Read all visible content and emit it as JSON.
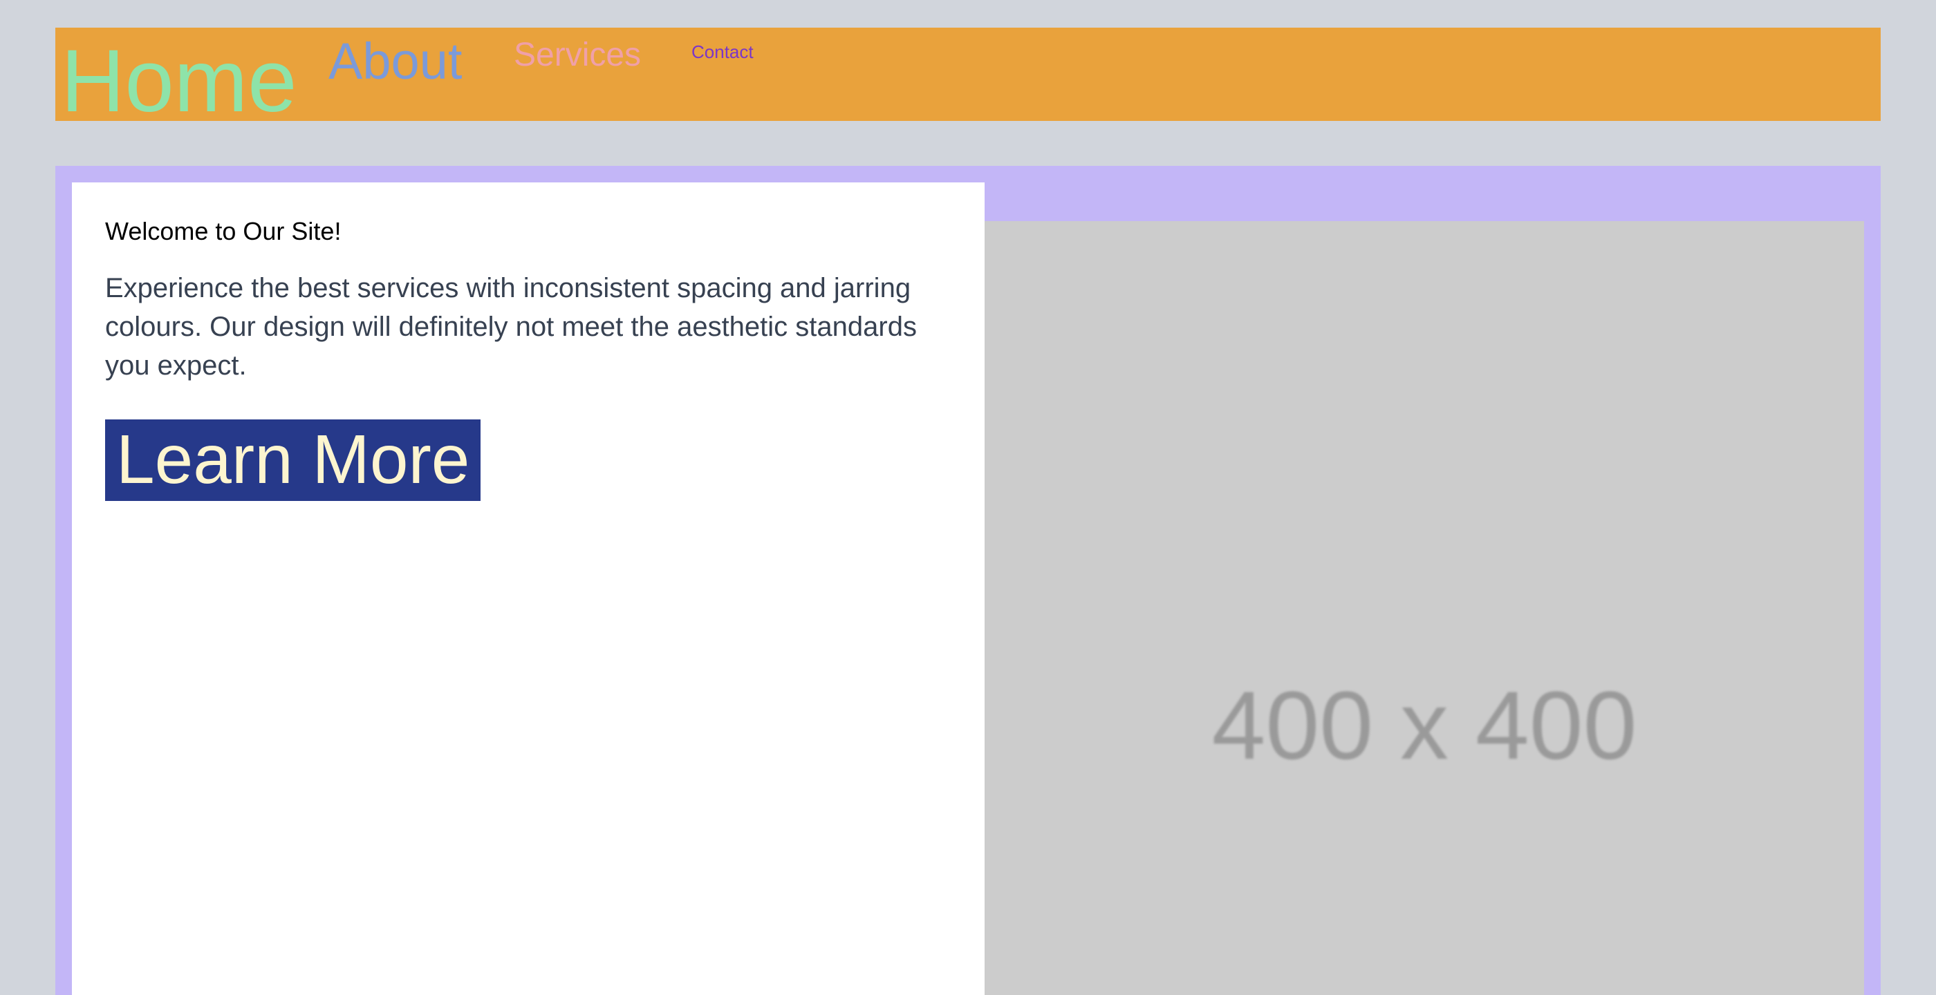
{
  "navbar": {
    "background": "#e9a23c",
    "items": [
      {
        "label": "Home",
        "color": "#8ee3a9"
      },
      {
        "label": "About",
        "color": "#7b9ad9"
      },
      {
        "label": "Services",
        "color": "#f0a0a8"
      },
      {
        "label": "Contact",
        "color": "#7b36c8"
      }
    ]
  },
  "main": {
    "background": "#c3b6f7",
    "card": {
      "heading": "Welcome to Our Site!",
      "text": "Experience the best services with inconsistent spacing and jarring colours. Our design will definitely not meet the aesthetic standards you expect.",
      "button_label": "Learn More",
      "button_background": "#26398a",
      "button_text_color": "#fdf5cf"
    },
    "image": {
      "label": "400 x 400",
      "background": "#cccccc"
    }
  }
}
